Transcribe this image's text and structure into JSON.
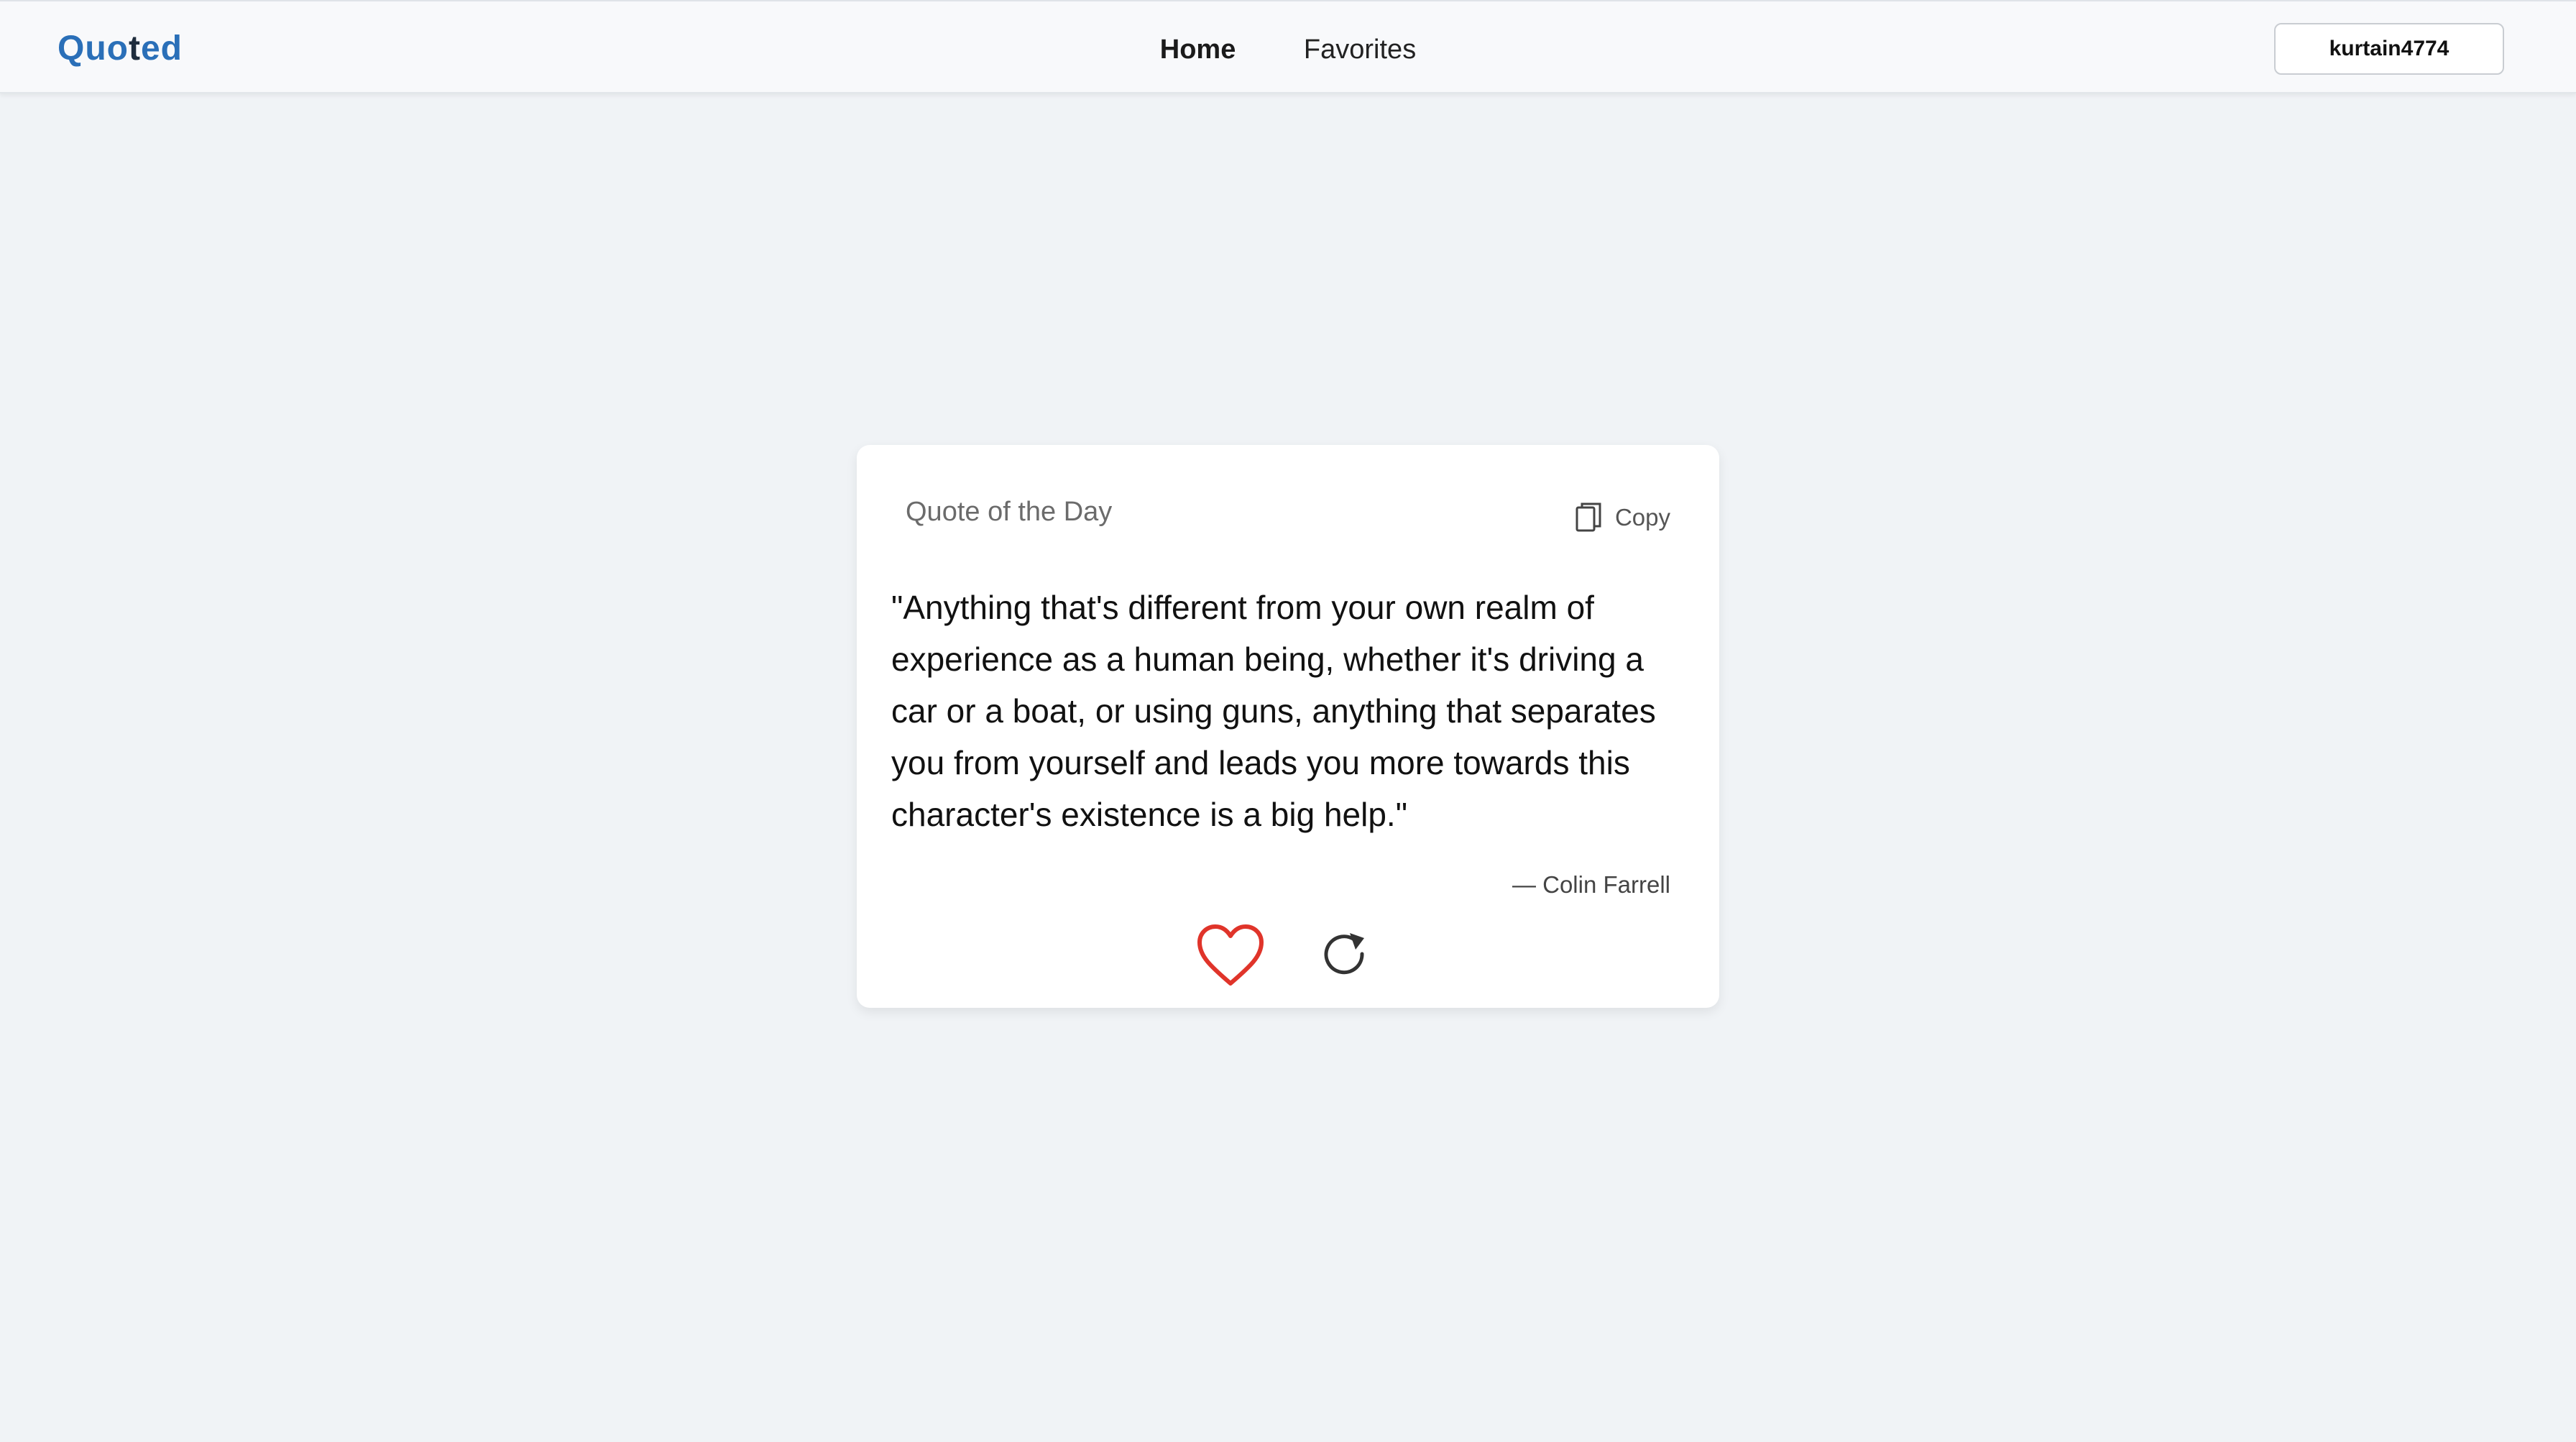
{
  "brand": {
    "part1": "Qu",
    "part2": "o",
    "part3": "t",
    "part4": "ed"
  },
  "nav": {
    "items": [
      {
        "label": "Home",
        "active": true
      },
      {
        "label": "Favorites",
        "active": false
      }
    ]
  },
  "user": {
    "name": "kurtain4774"
  },
  "card": {
    "title": "Quote of the Day",
    "copy_label": "Copy",
    "quote": "\"Anything that's different from your own realm of experience as a human being, whether it's driving a car or a boat, or using guns, anything that separates you from yourself and leads you more towards this character's existence is a big help.\"",
    "author": "— Colin Farrell"
  },
  "icons": {
    "copy": "copy-icon",
    "favorite": "heart-outline-icon",
    "refresh": "refresh-icon"
  },
  "colors": {
    "brand_blue": "#2a6fb8",
    "brand_dark": "#1f2d3d",
    "heart_red": "#e0342a",
    "background": "#f0f3f6"
  }
}
